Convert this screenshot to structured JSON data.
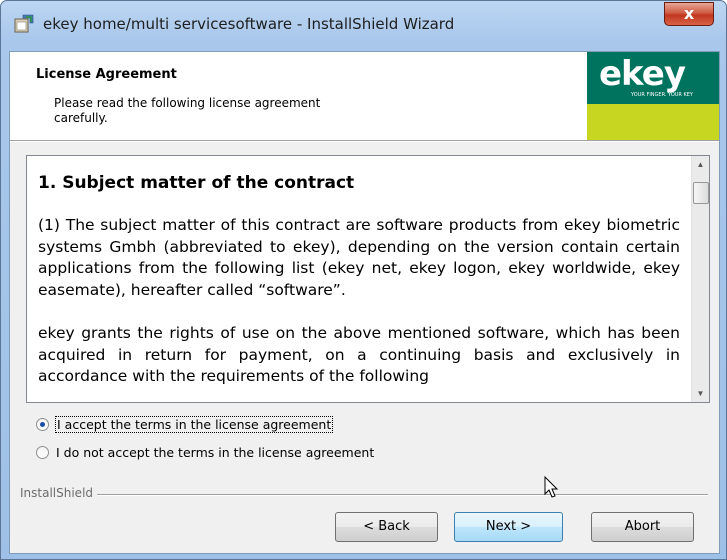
{
  "window": {
    "title": "ekey home/multi servicesoftware - InstallShield Wizard",
    "close_label": "x"
  },
  "header": {
    "title": "License Agreement",
    "subtitle": "Please read the following license agreement carefully.",
    "logo_text": "ekey",
    "logo_slogan": "YOUR FINGER. YOUR KEY"
  },
  "license": {
    "heading": "1. Subject matter of the contract",
    "paragraphs": [
      "(1) The subject matter of this contract are software products from ekey biometric systems Gmbh (abbreviated to ekey), depending on the version contain certain applications from the following list (ekey net, ekey logon, ekey worldwide, ekey easemate), hereafter called “software”.",
      "ekey grants the rights of use on the above mentioned software, which has been acquired in return for payment, on a continuing basis and exclusively in accordance with the requirements of the following"
    ]
  },
  "options": {
    "accept_label": "I accept the terms in the license agreement",
    "decline_label": "I do not accept the terms in the license agreement",
    "selected": "accept"
  },
  "footer": {
    "group_label": "InstallShield",
    "back_label": "< Back",
    "next_label": "Next >",
    "abort_label": "Abort"
  },
  "colors": {
    "logo_green": "#00735f",
    "logo_lime": "#c6d621",
    "close_red": "#c2361e"
  }
}
